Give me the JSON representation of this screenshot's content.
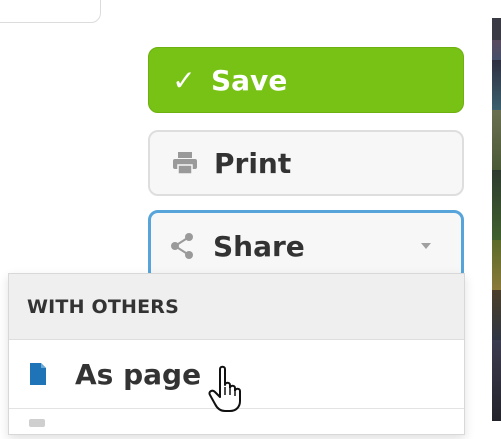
{
  "actions": {
    "save_label": "Save",
    "print_label": "Print",
    "share_label": "Share"
  },
  "share_menu": {
    "section_header": "WITH OTHERS",
    "items": [
      {
        "label": "As page",
        "icon": "document-icon"
      }
    ]
  },
  "colors": {
    "save_bg": "#77c214",
    "share_border": "#56a4d9",
    "doc_icon": "#1f74b8"
  },
  "icons": {
    "save": "checkmark-icon",
    "print": "printer-icon",
    "share": "share-icon",
    "dropdown": "caret-down-icon",
    "cursor": "hand-pointer-cursor"
  }
}
